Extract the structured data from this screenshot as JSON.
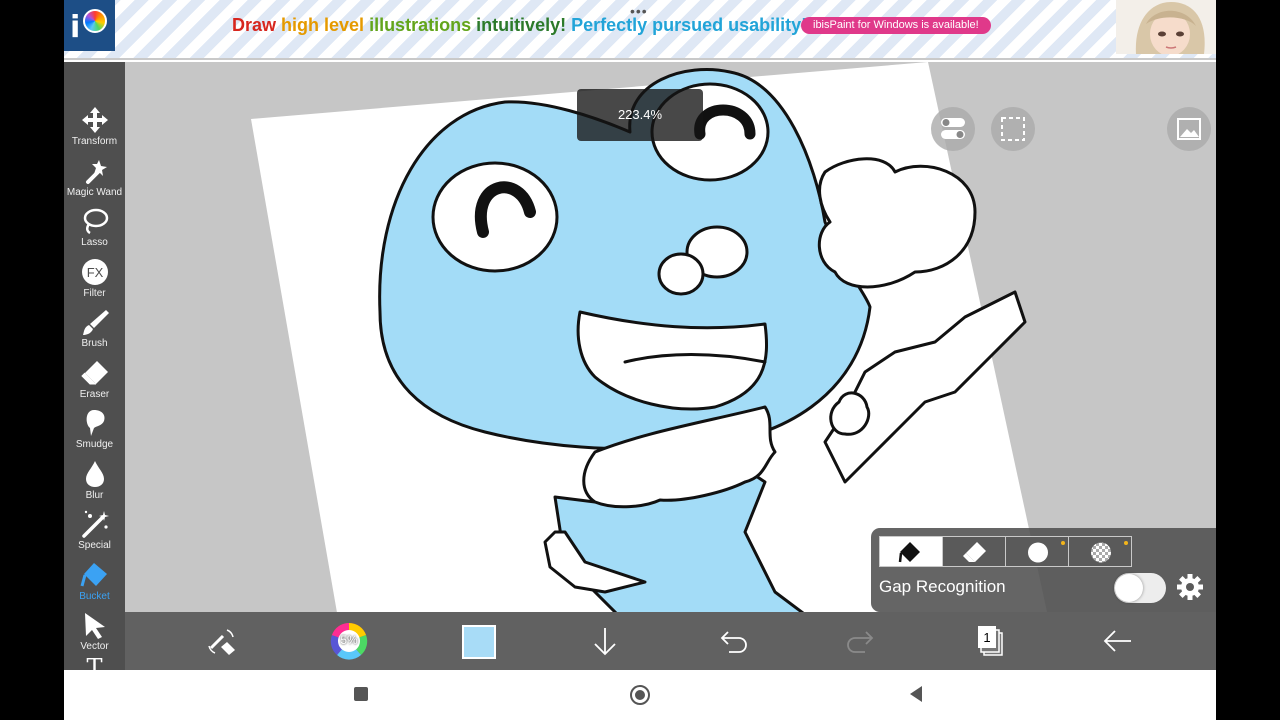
{
  "ad": {
    "headline_parts": [
      "Draw ",
      "high level ",
      "illustrations ",
      "intuitively! ",
      "Perfectly pursued usability!"
    ],
    "menu_dots": "•••",
    "pill": "ibisPaint for Windows is available!"
  },
  "zoom": {
    "label": "223.4%"
  },
  "tools": [
    {
      "label": "Transform",
      "icon": "move-icon"
    },
    {
      "label": "Magic Wand",
      "icon": "magic-wand-icon"
    },
    {
      "label": "Lasso",
      "icon": "lasso-icon"
    },
    {
      "label": "Filter",
      "icon": "fx-icon",
      "glyph": "FX"
    },
    {
      "label": "Brush",
      "icon": "brush-icon"
    },
    {
      "label": "Eraser",
      "icon": "eraser-icon"
    },
    {
      "label": "Smudge",
      "icon": "smudge-icon"
    },
    {
      "label": "Blur",
      "icon": "blur-drop-icon"
    },
    {
      "label": "Special",
      "icon": "special-icon"
    },
    {
      "label": "Bucket",
      "icon": "bucket-icon",
      "active": true
    },
    {
      "label": "Vector",
      "icon": "vector-cursor-icon"
    },
    {
      "label": "",
      "icon": "text-icon",
      "glyph": "T"
    }
  ],
  "bucket_panel": {
    "modes": [
      "fill-mode-icon",
      "eraser-mode-icon",
      "circle-mode-icon",
      "transparent-mode-icon"
    ],
    "gap_label": "Gap Recognition",
    "gap_enabled": false
  },
  "bottombar": {
    "color_wheel_label": "5%",
    "current_color": "#a8dcf7",
    "layer_count": "1"
  },
  "colors": {
    "accent": "#3ba2f3",
    "fill_blue": "#a3dcf7",
    "panel": "#4f4f4f"
  }
}
